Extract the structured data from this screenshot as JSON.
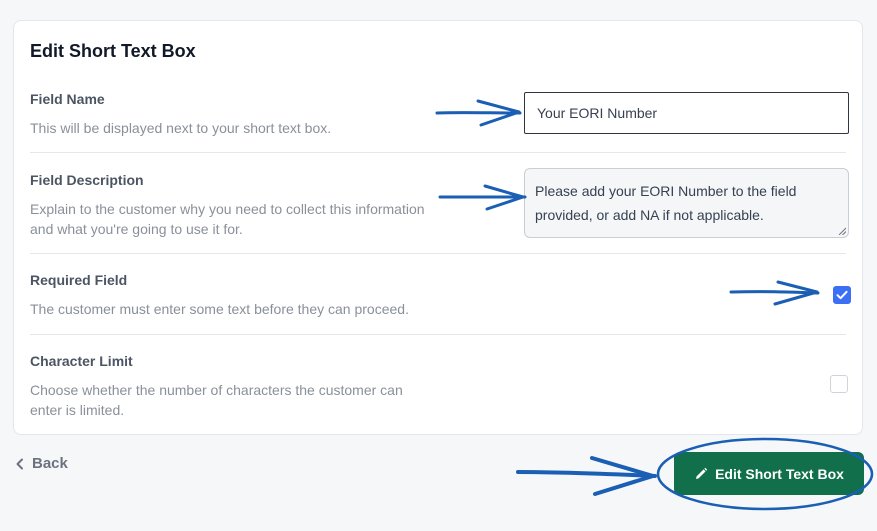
{
  "card": {
    "title": "Edit Short Text Box"
  },
  "field_name": {
    "label": "Field Name",
    "help": "This will be displayed next to your short text box.",
    "value": "Your EORI Number"
  },
  "field_description": {
    "label": "Field Description",
    "help": "Explain to the customer why you need to collect this information and what you're going to use it for.",
    "value": "Please add your EORI Number to the field provided, or add NA if not applicable."
  },
  "required_field": {
    "label": "Required Field",
    "help": "The customer must enter some text before they can proceed.",
    "checked": true
  },
  "character_limit": {
    "label": "Character Limit",
    "help": "Choose whether the number of characters the customer can enter is limited.",
    "checked": false
  },
  "footer": {
    "back_label": "Back",
    "submit_label": "Edit Short Text Box"
  },
  "icons": {
    "back": "chevron-left-icon",
    "submit": "pencil-icon",
    "check": "check-icon"
  },
  "colors": {
    "primary_button": "#11704b",
    "checkbox_checked": "#3b6ff5",
    "annotation": "#1a5fb4"
  }
}
